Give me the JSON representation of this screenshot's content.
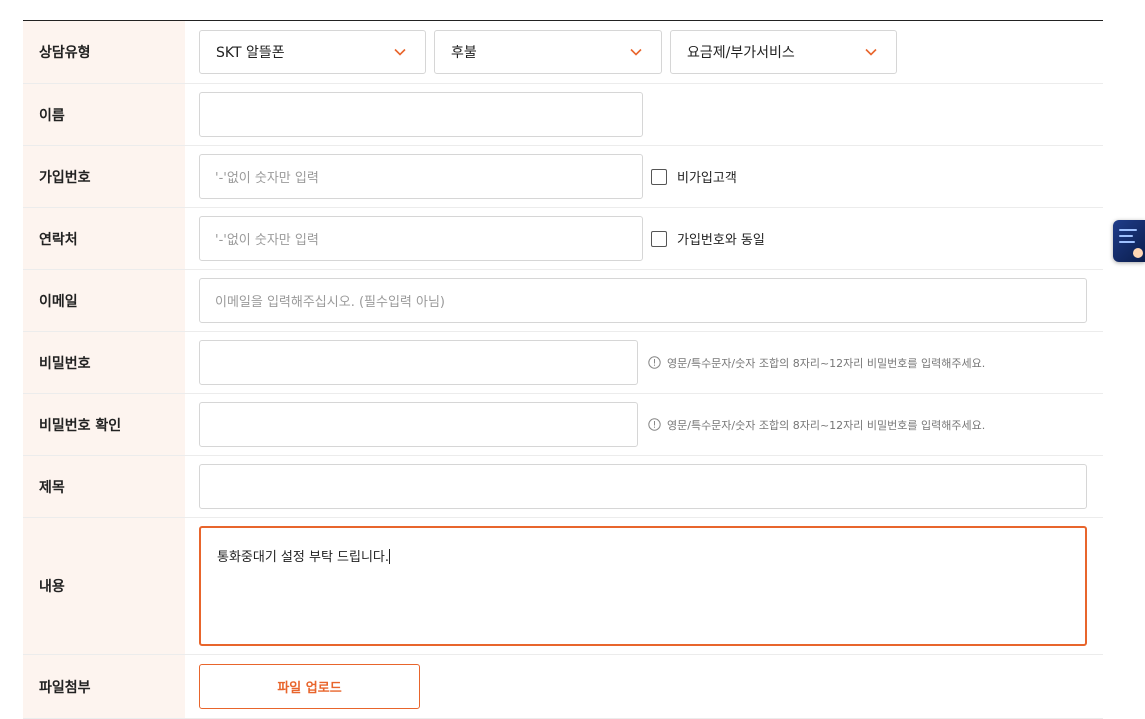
{
  "form": {
    "consult_type": {
      "label": "상담유형",
      "selects": [
        "SKT 알뜰폰",
        "후불",
        "요금제/부가서비스"
      ]
    },
    "name": {
      "label": "이름",
      "value": ""
    },
    "join_number": {
      "label": "가입번호",
      "placeholder": "'-'없이 숫자만 입력",
      "checkbox_label": "비가입고객"
    },
    "contact": {
      "label": "연락처",
      "placeholder": "'-'없이 숫자만 입력",
      "checkbox_label": "가입번호와 동일"
    },
    "email": {
      "label": "이메일",
      "placeholder": "이메일을 입력해주십시오. (필수입력 아님)"
    },
    "password": {
      "label": "비밀번호",
      "hint": "영문/특수문자/숫자 조합의 8자리~12자리 비밀번호를 입력해주세요."
    },
    "password_confirm": {
      "label": "비밀번호 확인",
      "hint": "영문/특수문자/숫자 조합의 8자리~12자리 비밀번호를 입력해주세요."
    },
    "subject": {
      "label": "제목",
      "value": ""
    },
    "content": {
      "label": "내용",
      "value": "통화중대기 설정 부탁 드립니다."
    },
    "file": {
      "label": "파일첨부",
      "button": "파일 업로드"
    }
  },
  "colors": {
    "accent": "#e8652c",
    "label_bg": "#fdf4ef",
    "border": "#d6d6d6"
  },
  "icons": {
    "select": "chevron-down-icon",
    "hint": "info-circle-icon"
  }
}
